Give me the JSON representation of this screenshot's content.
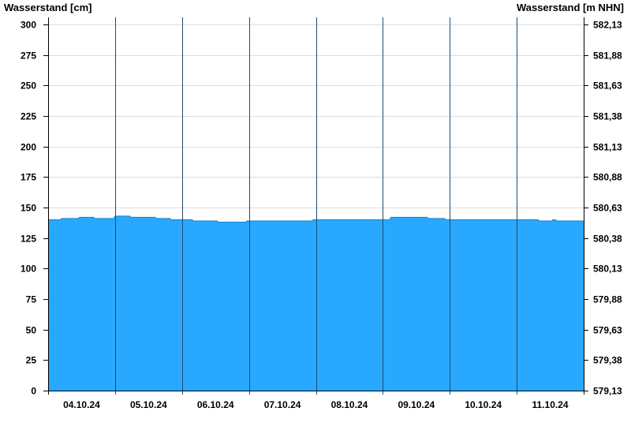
{
  "chart_data": {
    "type": "area",
    "ylabel_left": "Wasserstand [cm]",
    "ylabel_right": "Wasserstand [m NHN]",
    "ylim": [
      0,
      305
    ],
    "y_ticks_left": [
      {
        "v": 0,
        "label": "0"
      },
      {
        "v": 25,
        "label": "25"
      },
      {
        "v": 50,
        "label": "50"
      },
      {
        "v": 75,
        "label": "75"
      },
      {
        "v": 100,
        "label": "100"
      },
      {
        "v": 125,
        "label": "125"
      },
      {
        "v": 150,
        "label": "150"
      },
      {
        "v": 175,
        "label": "175"
      },
      {
        "v": 200,
        "label": "200"
      },
      {
        "v": 225,
        "label": "225"
      },
      {
        "v": 250,
        "label": "250"
      },
      {
        "v": 275,
        "label": "275"
      },
      {
        "v": 300,
        "label": "300"
      }
    ],
    "y_ticks_right": [
      {
        "v": 0,
        "label": "579,13"
      },
      {
        "v": 25,
        "label": "579,38"
      },
      {
        "v": 50,
        "label": "579,63"
      },
      {
        "v": 75,
        "label": "579,88"
      },
      {
        "v": 100,
        "label": "580,13"
      },
      {
        "v": 125,
        "label": "580,38"
      },
      {
        "v": 150,
        "label": "580,63"
      },
      {
        "v": 175,
        "label": "580,88"
      },
      {
        "v": 200,
        "label": "581,13"
      },
      {
        "v": 225,
        "label": "581,38"
      },
      {
        "v": 250,
        "label": "581,63"
      },
      {
        "v": 275,
        "label": "581,88"
      },
      {
        "v": 300,
        "label": "582,13"
      }
    ],
    "x_range_days": [
      0,
      8
    ],
    "x_labels": [
      {
        "day": 0.5,
        "label": "04.10.24"
      },
      {
        "day": 1.5,
        "label": "05.10.24"
      },
      {
        "day": 2.5,
        "label": "06.10.24"
      },
      {
        "day": 3.5,
        "label": "07.10.24"
      },
      {
        "day": 4.5,
        "label": "08.10.24"
      },
      {
        "day": 5.5,
        "label": "09.10.24"
      },
      {
        "day": 6.5,
        "label": "10.10.24"
      },
      {
        "day": 7.5,
        "label": "11.10.24"
      }
    ],
    "day_dividers": [
      1,
      2,
      3,
      4,
      5,
      6,
      7
    ],
    "grid": true,
    "fill_color": "#29a8ff",
    "series": [
      {
        "x": [
          0,
          0.19,
          0.2,
          0.45,
          0.47,
          0.68,
          0.7,
          0.98,
          1.0,
          1.22,
          1.24,
          1.6,
          1.62,
          1.82,
          1.84,
          2.15,
          2.17,
          2.52,
          2.55,
          2.95,
          2.97,
          3.2,
          3.22,
          3.5,
          3.52,
          3.94,
          3.96,
          4.3,
          4.32,
          4.98,
          5.0,
          5.1,
          5.12,
          5.66,
          5.68,
          5.92,
          5.94,
          6.3,
          6.32,
          6.98,
          7.0,
          7.32,
          7.34,
          7.52,
          7.54,
          7.58,
          7.6,
          8.0
        ],
        "y": [
          140,
          140,
          141,
          141,
          142,
          142,
          141,
          141,
          143,
          143,
          142,
          142,
          141,
          141,
          140,
          140,
          139,
          139,
          138,
          138,
          139,
          139,
          139,
          139,
          139,
          139,
          140,
          140,
          140,
          140,
          140,
          140,
          142,
          142,
          141,
          141,
          140,
          140,
          140,
          140,
          140,
          140,
          139,
          139,
          140,
          140,
          139,
          139
        ]
      }
    ]
  }
}
